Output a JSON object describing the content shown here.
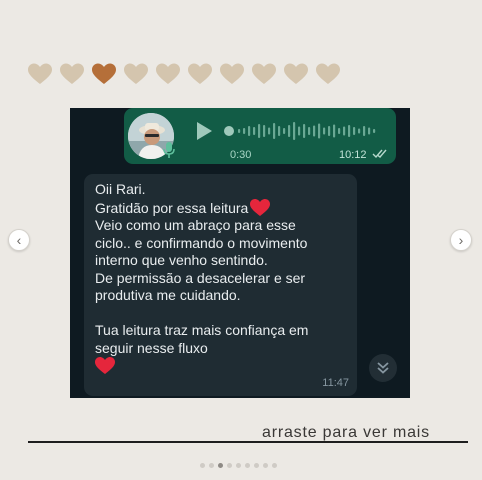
{
  "hearts": {
    "count": 10,
    "active_index": 2,
    "color": "#d4c5ae",
    "active_color": "#b56f39"
  },
  "carousel": {
    "prev_icon": "chevron-left-icon",
    "next_icon": "chevron-right-icon",
    "prev_glyph": "‹",
    "next_glyph": "›",
    "dot_count": 9,
    "active_dot": 2
  },
  "audio": {
    "duration": "0:30",
    "time": "10:12",
    "status_icon": "double-check-icon",
    "bubble_color": "#125c46"
  },
  "message": {
    "lines": [
      "Oii Rari.",
      "Gratidão por essa leitura",
      "Veio como um abraço para esse",
      "ciclo.. e confirmando o movimento",
      "interno que venho sentindo.",
      "De permissão a desacelerar e ser",
      "produtiva me cuidando.",
      "",
      "Tua leitura traz mais confiança em",
      "seguir nesse fluxo"
    ],
    "time": "11:47",
    "bubble_color": "#1f2c33"
  },
  "footer": {
    "swipe_text": "arraste para ver mais"
  }
}
